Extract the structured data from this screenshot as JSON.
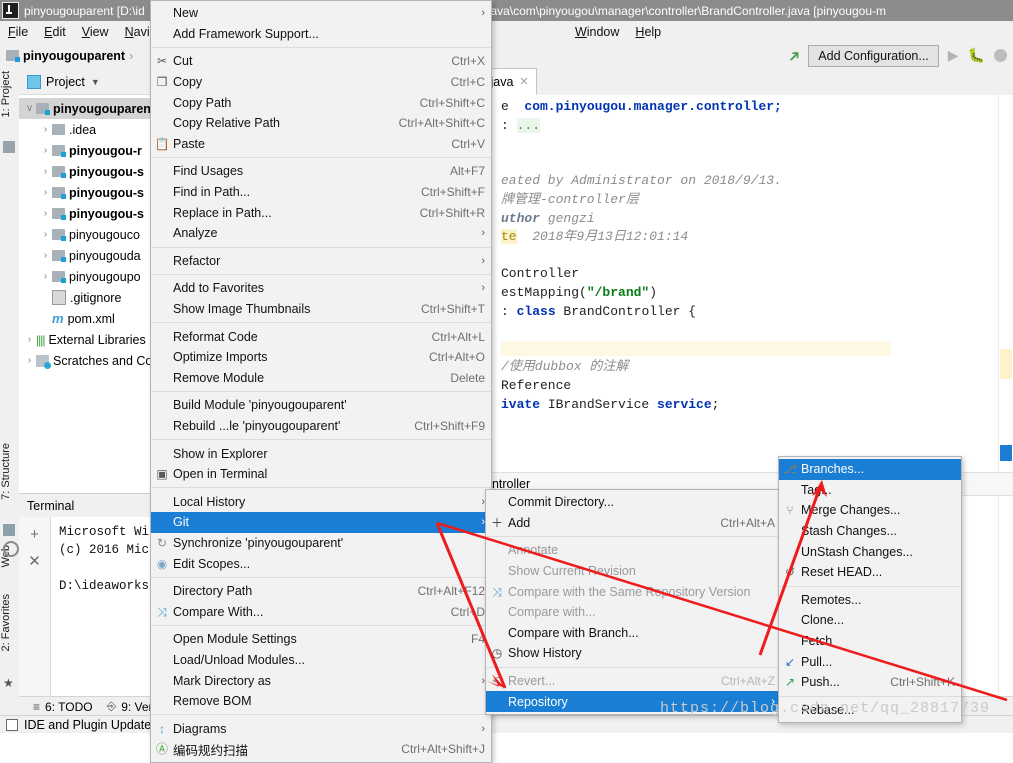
{
  "window": {
    "title": "pinyougouparent [D:\\id",
    "title_right": "web\\src\\main\\java\\com\\pinyougou\\manager\\controller\\BrandController.java [pinyougou-m",
    "icon": "idea-logo-icon"
  },
  "menubar": {
    "items": [
      "File",
      "Edit",
      "View",
      "Navigate",
      "Window",
      "Help"
    ]
  },
  "navbar": {
    "breadcrumb": "pinyougouparent",
    "separator": "›",
    "add_configuration": "Add Configuration...",
    "run_icon": "run-arrow-icon",
    "debug_icon": "debug-bug-icon",
    "build_icon": "build-hammer-icon"
  },
  "left_strips": [
    {
      "label": "1: Project",
      "name": "tool-window-project"
    },
    {
      "label": "7: Structure",
      "name": "tool-window-structure"
    },
    {
      "label": "Web",
      "name": "tool-window-web"
    },
    {
      "label": "2: Favorites",
      "name": "tool-window-favorites"
    }
  ],
  "project_panel": {
    "header": "Project",
    "tree": [
      {
        "indent": 0,
        "arrow": "∨",
        "icon": "module-folder-icon",
        "label": "pinyougouparen",
        "bold": true,
        "selected": true
      },
      {
        "indent": 1,
        "arrow": "›",
        "icon": "folder-icon",
        "label": ".idea",
        "bold": false
      },
      {
        "indent": 1,
        "arrow": "›",
        "icon": "module-folder-icon",
        "label": "pinyougou-r",
        "bold": true
      },
      {
        "indent": 1,
        "arrow": "›",
        "icon": "module-folder-icon",
        "label": "pinyougou-s",
        "bold": true
      },
      {
        "indent": 1,
        "arrow": "›",
        "icon": "module-folder-icon",
        "label": "pinyougou-s",
        "bold": true
      },
      {
        "indent": 1,
        "arrow": "›",
        "icon": "module-folder-icon",
        "label": "pinyougou-s",
        "bold": true
      },
      {
        "indent": 1,
        "arrow": "›",
        "icon": "module-folder-icon",
        "label": "pinyougouco",
        "bold": false
      },
      {
        "indent": 1,
        "arrow": "›",
        "icon": "module-folder-icon",
        "label": "pinyougouda",
        "bold": false
      },
      {
        "indent": 1,
        "arrow": "›",
        "icon": "module-folder-icon",
        "label": "pinyougoupo",
        "bold": false
      },
      {
        "indent": 1,
        "arrow": "",
        "icon": "gitignore-file-icon",
        "label": ".gitignore",
        "bold": false
      },
      {
        "indent": 1,
        "arrow": "",
        "icon": "maven-pom-icon",
        "label": "pom.xml",
        "bold": false
      },
      {
        "indent": 0,
        "arrow": "›",
        "icon": "external-libraries-icon",
        "label": "External Libraries",
        "bold": false
      },
      {
        "indent": 0,
        "arrow": "›",
        "icon": "scratches-icon",
        "label": "Scratches and Co",
        "bold": false
      }
    ]
  },
  "terminal": {
    "title": "Terminal",
    "add_icon": "+",
    "close_icon": "✕",
    "lines": [
      "Microsoft Wi",
      "(c) 2016 Mic",
      "",
      "D:\\ideaworks"
    ]
  },
  "editor": {
    "tab_label": ".java",
    "tab_close": "✕",
    "lines": [
      {
        "type": "fold",
        "text": "• ..."
      },
      {
        "type": "blank",
        "text": ""
      },
      {
        "type": "blank",
        "text": ""
      },
      {
        "type": "comment",
        "text": "eated by Administrator on 2018/9/13."
      },
      {
        "type": "comment",
        "text": "牌管理-controller层"
      },
      {
        "type": "comment-tag",
        "text": "uthor gengzi"
      },
      {
        "type": "comment-tag-hl",
        "text": "te  2018年9月13日12:01:14"
      },
      {
        "type": "blank",
        "text": ""
      },
      {
        "type": "annot",
        "text": "Controller"
      },
      {
        "type": "annot-str",
        "text": "estMapping(\"/brand\")"
      },
      {
        "type": "decl",
        "text": " class BrandController {"
      },
      {
        "type": "blank",
        "text": ""
      },
      {
        "type": "hl-blank",
        "text": ""
      },
      {
        "type": "comment",
        "text": "/使用dubbox 的注解"
      },
      {
        "type": "annot",
        "text": "Reference"
      },
      {
        "type": "decl2",
        "text": "ivate IBrandService service;"
      }
    ],
    "bottom_crumb": "ontroller"
  },
  "context_menu": {
    "items": [
      {
        "icon": "",
        "label": "New",
        "accel": "",
        "arrow": "›",
        "sep_after": false
      },
      {
        "icon": "",
        "label": "Add Framework Support...",
        "accel": "",
        "arrow": "",
        "sep_after": true
      },
      {
        "icon": "cut-icon",
        "label": "Cut",
        "accel": "Ctrl+X",
        "arrow": "",
        "sep_after": false
      },
      {
        "icon": "copy-icon",
        "label": "Copy",
        "accel": "Ctrl+C",
        "arrow": "",
        "sep_after": false
      },
      {
        "icon": "",
        "label": "Copy Path",
        "accel": "Ctrl+Shift+C",
        "arrow": "",
        "sep_after": false
      },
      {
        "icon": "",
        "label": "Copy Relative Path",
        "accel": "Ctrl+Alt+Shift+C",
        "arrow": "",
        "sep_after": false
      },
      {
        "icon": "paste-icon",
        "label": "Paste",
        "accel": "Ctrl+V",
        "arrow": "",
        "sep_after": true
      },
      {
        "icon": "",
        "label": "Find Usages",
        "accel": "Alt+F7",
        "arrow": "",
        "sep_after": false
      },
      {
        "icon": "",
        "label": "Find in Path...",
        "accel": "Ctrl+Shift+F",
        "arrow": "",
        "sep_after": false
      },
      {
        "icon": "",
        "label": "Replace in Path...",
        "accel": "Ctrl+Shift+R",
        "arrow": "",
        "sep_after": false
      },
      {
        "icon": "",
        "label": "Analyze",
        "accel": "",
        "arrow": "›",
        "sep_after": true
      },
      {
        "icon": "",
        "label": "Refactor",
        "accel": "",
        "arrow": "›",
        "sep_after": true
      },
      {
        "icon": "",
        "label": "Add to Favorites",
        "accel": "",
        "arrow": "›",
        "sep_after": false
      },
      {
        "icon": "",
        "label": "Show Image Thumbnails",
        "accel": "Ctrl+Shift+T",
        "arrow": "",
        "sep_after": true
      },
      {
        "icon": "",
        "label": "Reformat Code",
        "accel": "Ctrl+Alt+L",
        "arrow": "",
        "sep_after": false
      },
      {
        "icon": "",
        "label": "Optimize Imports",
        "accel": "Ctrl+Alt+O",
        "arrow": "",
        "sep_after": false
      },
      {
        "icon": "",
        "label": "Remove Module",
        "accel": "Delete",
        "arrow": "",
        "sep_after": true
      },
      {
        "icon": "",
        "label": "Build Module 'pinyougouparent'",
        "accel": "",
        "arrow": "",
        "sep_after": false
      },
      {
        "icon": "",
        "label": "Rebuild ...le 'pinyougouparent'",
        "accel": "Ctrl+Shift+F9",
        "arrow": "",
        "sep_after": true
      },
      {
        "icon": "",
        "label": "Show in Explorer",
        "accel": "",
        "arrow": "",
        "sep_after": false
      },
      {
        "icon": "terminal-icon",
        "label": "Open in Terminal",
        "accel": "",
        "arrow": "",
        "sep_after": true
      },
      {
        "icon": "",
        "label": "Local History",
        "accel": "",
        "arrow": "›",
        "sep_after": false
      },
      {
        "icon": "",
        "label": "Git",
        "accel": "",
        "arrow": "›",
        "selected": true,
        "sep_after": false
      },
      {
        "icon": "sync-icon",
        "label": "Synchronize 'pinyougouparent'",
        "accel": "",
        "arrow": "",
        "sep_after": false
      },
      {
        "icon": "scope-icon",
        "label": "Edit Scopes...",
        "accel": "",
        "arrow": "",
        "sep_after": true
      },
      {
        "icon": "",
        "label": "Directory Path",
        "accel": "Ctrl+Alt+F12",
        "arrow": "",
        "sep_after": false
      },
      {
        "icon": "compare-icon",
        "label": "Compare With...",
        "accel": "Ctrl+D",
        "arrow": "",
        "sep_after": true
      },
      {
        "icon": "",
        "label": "Open Module Settings",
        "accel": "F4",
        "arrow": "",
        "sep_after": false
      },
      {
        "icon": "",
        "label": "Load/Unload Modules...",
        "accel": "",
        "arrow": "",
        "sep_after": false
      },
      {
        "icon": "",
        "label": "Mark Directory as",
        "accel": "",
        "arrow": "›",
        "sep_after": false
      },
      {
        "icon": "",
        "label": "Remove BOM",
        "accel": "",
        "arrow": "",
        "sep_after": true
      },
      {
        "icon": "diagram-icon",
        "label": "Diagrams",
        "accel": "",
        "arrow": "›",
        "sep_after": false
      },
      {
        "icon": "chinese-icon",
        "label": "编码规约扫描",
        "accel": "Ctrl+Alt+Shift+J",
        "arrow": "",
        "sep_after": false
      }
    ]
  },
  "git_submenu": {
    "items": [
      {
        "icon": "",
        "label": "Commit Directory...",
        "accel": "",
        "disabled": false,
        "sep_after": false
      },
      {
        "icon": "plus-icon",
        "label": "Add",
        "accel": "Ctrl+Alt+A",
        "disabled": false,
        "sep_after": true
      },
      {
        "icon": "",
        "label": "Annotate",
        "accel": "",
        "disabled": true,
        "sep_after": false
      },
      {
        "icon": "",
        "label": "Show Current Revision",
        "accel": "",
        "disabled": true,
        "sep_after": false
      },
      {
        "icon": "compare-icon",
        "label": "Compare with the Same Repository Version",
        "accel": "",
        "disabled": true,
        "sep_after": false
      },
      {
        "icon": "",
        "label": "Compare with...",
        "accel": "",
        "disabled": true,
        "sep_after": false
      },
      {
        "icon": "",
        "label": "Compare with Branch...",
        "accel": "",
        "disabled": false,
        "sep_after": false
      },
      {
        "icon": "clock-icon",
        "label": "Show History",
        "accel": "",
        "disabled": false,
        "sep_after": true
      },
      {
        "icon": "revert-icon",
        "label": "Revert...",
        "accel": "Ctrl+Alt+Z",
        "disabled": true,
        "sep_after": false
      },
      {
        "icon": "",
        "label": "Repository",
        "accel": "",
        "arrow": "›",
        "selected": true,
        "disabled": false,
        "sep_after": false
      }
    ]
  },
  "repository_submenu": {
    "items": [
      {
        "icon": "branch-icon",
        "label": "Branches...",
        "accel": "",
        "selected": true,
        "sep_after": false
      },
      {
        "icon": "",
        "label": "Tag...",
        "accel": "",
        "sep_after": false
      },
      {
        "icon": "merge-icon",
        "label": "Merge Changes...",
        "accel": "",
        "sep_after": false
      },
      {
        "icon": "",
        "label": "Stash Changes...",
        "accel": "",
        "sep_after": false
      },
      {
        "icon": "",
        "label": "UnStash Changes...",
        "accel": "",
        "sep_after": false
      },
      {
        "icon": "reset-icon",
        "label": "Reset HEAD...",
        "accel": "",
        "sep_after": true
      },
      {
        "icon": "",
        "label": "Remotes...",
        "accel": "",
        "sep_after": false
      },
      {
        "icon": "",
        "label": "Clone...",
        "accel": "",
        "sep_after": false
      },
      {
        "icon": "",
        "label": "Fetch",
        "accel": "",
        "sep_after": false
      },
      {
        "icon": "pull-icon",
        "label": "Pull...",
        "accel": "",
        "sep_after": false
      },
      {
        "icon": "push-icon",
        "label": "Push...",
        "accel": "Ctrl+Shift+K",
        "sep_after": true
      },
      {
        "icon": "",
        "label": "Rebase...",
        "accel": "",
        "sep_after": false
      }
    ]
  },
  "status_bar": {
    "items": [
      {
        "icon": "todo-icon",
        "label": "6: TODO"
      },
      {
        "icon": "version-control-icon",
        "label": "9: Ver"
      }
    ]
  },
  "bottom_bar": {
    "label": "IDE and Plugin Update"
  },
  "watermark": "https://blog.csdn.net/qq_28817739",
  "colors": {
    "selection_blue": "#1a7fd4",
    "menu_bg": "#f2f2f2",
    "titlebar_bg": "#8c8c8c",
    "annotation_red": "#ee1c1c",
    "string_green": "#067d17",
    "keyword_blue": "#0033b3"
  }
}
